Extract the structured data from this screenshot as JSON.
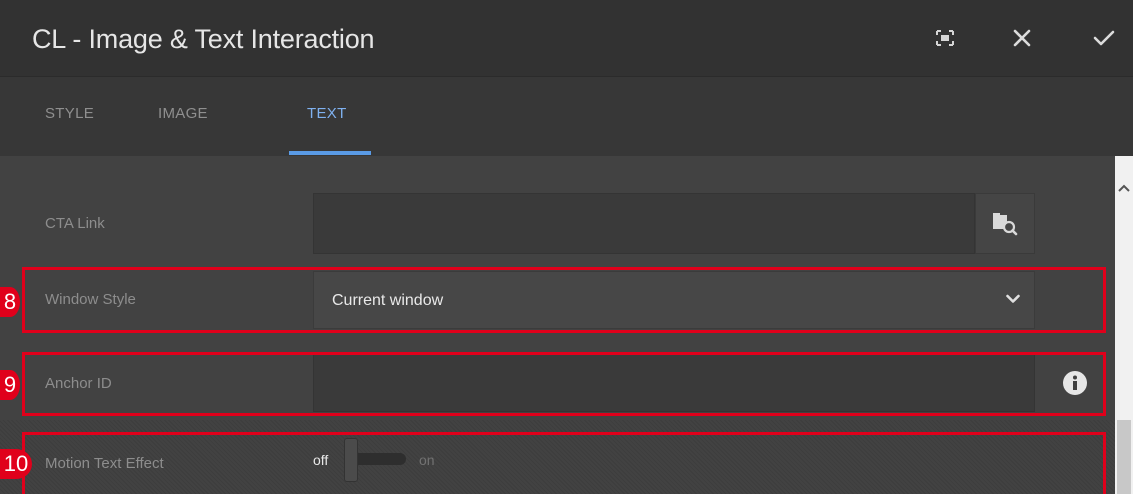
{
  "dialog": {
    "title": "CL - Image & Text Interaction",
    "actions": [
      "fullscreen-icon",
      "close-icon",
      "check-icon"
    ]
  },
  "tabs": [
    {
      "label": "STYLE",
      "active": false
    },
    {
      "label": "IMAGE",
      "active": false
    },
    {
      "label": "TEXT",
      "active": true
    }
  ],
  "form": {
    "cta_link": {
      "label": "CTA Link",
      "value": "",
      "browse_icon": "folder-search-icon"
    },
    "window_style": {
      "label": "Window Style",
      "value": "Current window",
      "dropdown_icon": "chevron-down-icon"
    },
    "anchor_id": {
      "label": "Anchor ID",
      "value": "",
      "info_icon": "info-icon"
    },
    "motion_text_effect": {
      "label": "Motion Text Effect",
      "off_label": "off",
      "on_label": "on",
      "state": "off"
    }
  },
  "annotations": [
    {
      "number": "8",
      "target": "Window Style"
    },
    {
      "number": "9",
      "target": "Anchor ID"
    },
    {
      "number": "10",
      "target": "Motion Text Effect"
    }
  ],
  "colors": {
    "accent": "#5a9be6",
    "annotation_red": "#e0001b",
    "titlebar": "#323232",
    "background": "#424242"
  }
}
